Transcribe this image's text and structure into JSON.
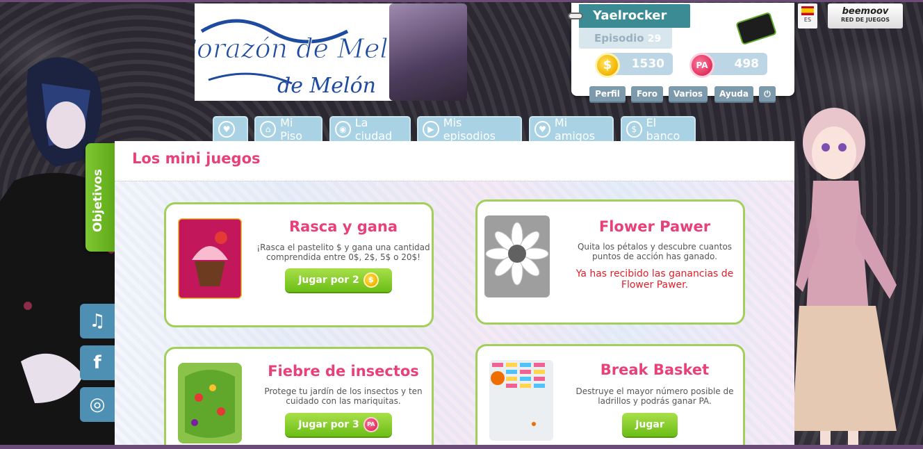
{
  "header": {
    "logo_text": "Corazón de Melón"
  },
  "user": {
    "name": "Yaelrocker",
    "episode_label": "Episodio",
    "episode_number": "29",
    "coins": "1530",
    "coin_symbol": "$",
    "pa": "498",
    "pa_symbol": "PA"
  },
  "user_menu": [
    "Perfil",
    "Foro",
    "Varios",
    "Ayuda",
    "⏻"
  ],
  "lang": {
    "code": "ES"
  },
  "beemoov": {
    "brand": "beemoov",
    "sub": "RED DE JUEGOS"
  },
  "nav": {
    "tabs": [
      {
        "label": "",
        "icon": "hearts-icon"
      },
      {
        "label": "Mi Piso",
        "icon": "house-icon"
      },
      {
        "label": "La ciudad",
        "icon": "location-pin-icon"
      },
      {
        "label": "Mis episodios",
        "icon": "play-icon"
      },
      {
        "label": "Mi amigos",
        "icon": "heart-icon"
      },
      {
        "label": "El banco",
        "icon": "dollar-coin-icon"
      }
    ]
  },
  "sidebar": {
    "objetivos": "Objetivos",
    "social": [
      {
        "icon": "music-note-icon",
        "glyph": "♫"
      },
      {
        "icon": "facebook-icon",
        "glyph": "f"
      },
      {
        "icon": "instagram-icon",
        "glyph": "◎"
      }
    ]
  },
  "main": {
    "title": "Los mini juegos",
    "games": [
      {
        "title": "Rasca y gana",
        "description": "¡Rasca el pastelito $ y gana una cantidad comprendida entre 0$, 2$, 5$ o 20$!",
        "button": "Jugar por 2",
        "cost_symbol": "$"
      },
      {
        "title": "Flower Pawer",
        "description": "Quita los pétalos y descubre cuantos puntos de acción has ganado.",
        "status": "Ya has recibido las ganancias de Flower Pawer."
      },
      {
        "title": "Fiebre de insectos",
        "description": "Protege tu jardín de los insectos y ten cuidado con las mariquitas.",
        "button": "Jugar por 3",
        "cost_symbol": "PA"
      },
      {
        "title": "Break Basket",
        "description": "Destruye el mayor número posible de ladrillos y podrás ganar PA.",
        "button": "Jugar"
      }
    ]
  },
  "colors": {
    "accent_pink": "#e8407a",
    "card_border_green": "#a2cf5a",
    "tab_blue": "#a9d3e4",
    "user_name_teal": "#3b8b95"
  }
}
